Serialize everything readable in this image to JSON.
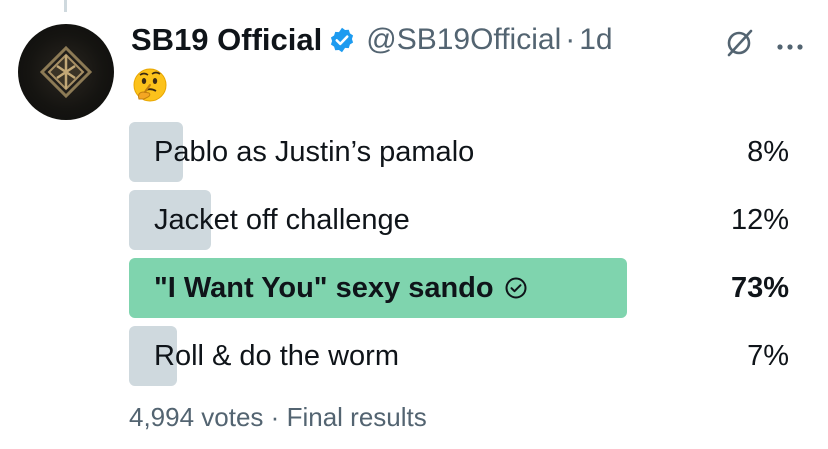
{
  "tweet": {
    "display_name": "SB19 Official",
    "handle": "@SB19Official",
    "separator": "·",
    "time": "1d",
    "emoji": "🤔",
    "icons": {
      "avatar": "sb19-logo-avatar",
      "verified": "verified-badge-icon",
      "grok": "grok-icon",
      "more": "more-options-icon"
    }
  },
  "poll": {
    "options": [
      {
        "label": "Pablo as Justin’s pamalo",
        "percent_text": "8%",
        "share": 0.08,
        "winner": false
      },
      {
        "label": "Jacket off challenge",
        "percent_text": "12%",
        "share": 0.12,
        "winner": false
      },
      {
        "label": "\"I Want You\" sexy sando",
        "percent_text": "73%",
        "share": 0.73,
        "winner": true
      },
      {
        "label": "Roll & do the worm",
        "percent_text": "7%",
        "share": 0.07,
        "winner": false
      }
    ],
    "votes": "4,994 votes",
    "separator": "·",
    "status": "Final results"
  },
  "colors": {
    "bar_default": "#cfd9de",
    "bar_winner": "#7fd4ae",
    "verified": "#1d9bf0",
    "secondary_text": "#536471"
  }
}
